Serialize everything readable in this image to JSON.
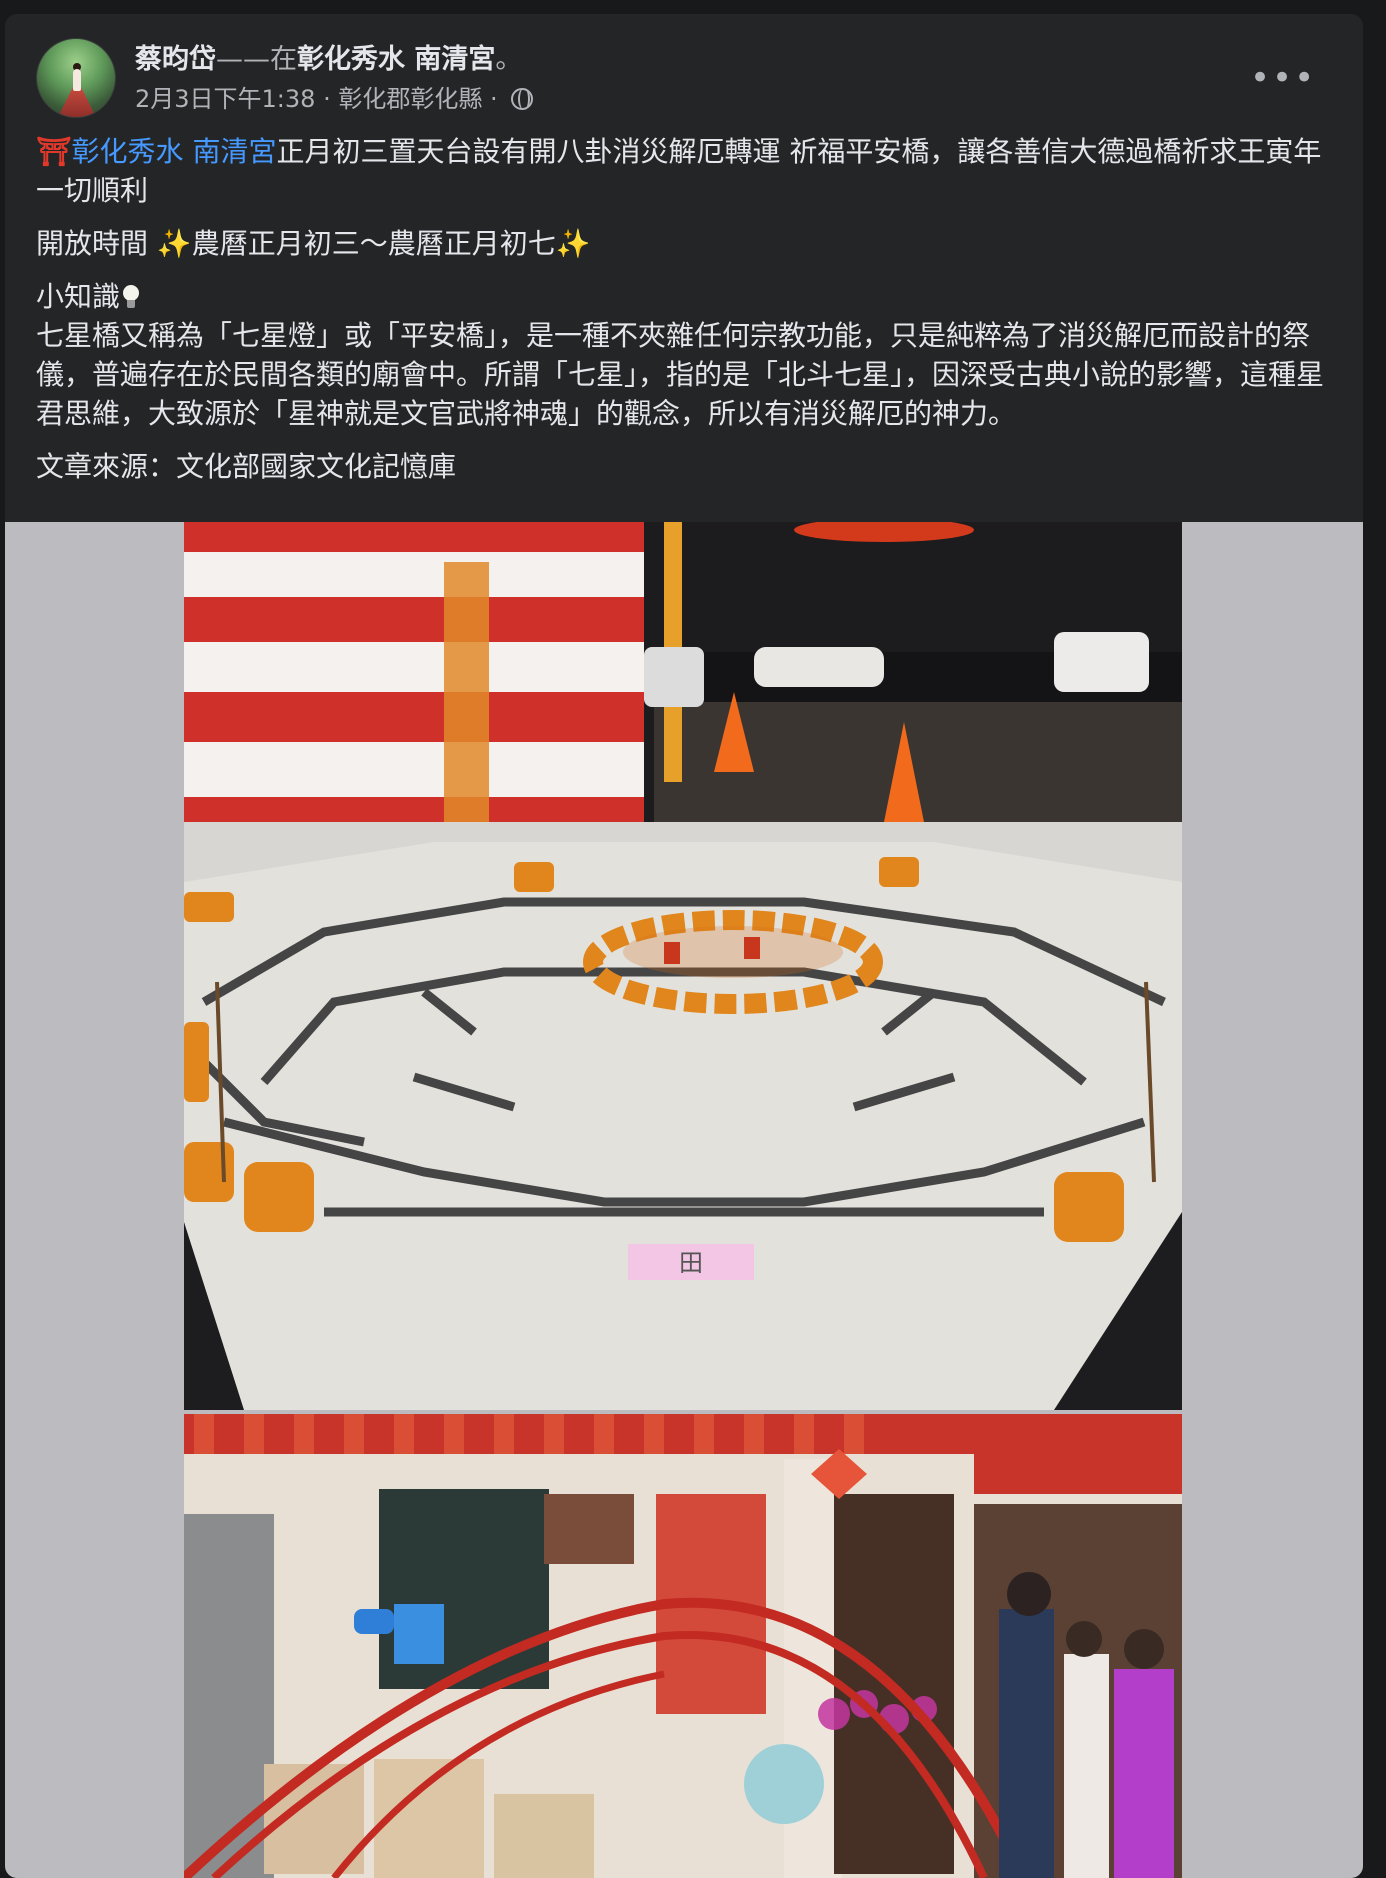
{
  "post": {
    "author": "蔡昀岱",
    "separator": "——在",
    "place": "彰化秀水 南清宮",
    "place_suffix": "。",
    "date": "2月3日下午1:38",
    "location": "彰化郡彰化縣",
    "dot": "·",
    "more_label": "•••",
    "para1_icon": "⛩",
    "para1_link": "彰化秀水 南清宮",
    "para1_text": "正月初三置天台設有開八卦消災解厄轉運  祈福平安橋，讓各善信大德過橋祈求王寅年一切順利",
    "para2_prefix": "開放時間 ",
    "sparkle": "✨",
    "para2_text": "農曆正月初三～農曆正月初七",
    "para3_title": "小知識",
    "para3_body": "七星橋又稱為「七星燈」或「平安橋」，是一種不夾雜任何宗教功能，只是純粹為了消災解厄而設計的祭儀，普遍存在於民間各類的廟會中。所謂「七星」，指的是「北斗七星」，因深受古典小說的影響，這種星君思維，大致源於「星神就是文官武將神魂」的觀念，所以有消災解厄的神力。",
    "para4": "文章來源：文化部國家文化記憶庫"
  },
  "photos": {
    "floor_sign": "田",
    "icons": [
      "globe-icon",
      "more-icon",
      "torii-icon",
      "sparkle-icon",
      "lightbulb-icon"
    ]
  },
  "colors": {
    "card_bg": "#242526",
    "page_bg": "#18191a",
    "link": "#4599ff",
    "text": "#e4e6eb",
    "muted": "#b0b3b8",
    "photo_bg": "#bcbbc0"
  }
}
